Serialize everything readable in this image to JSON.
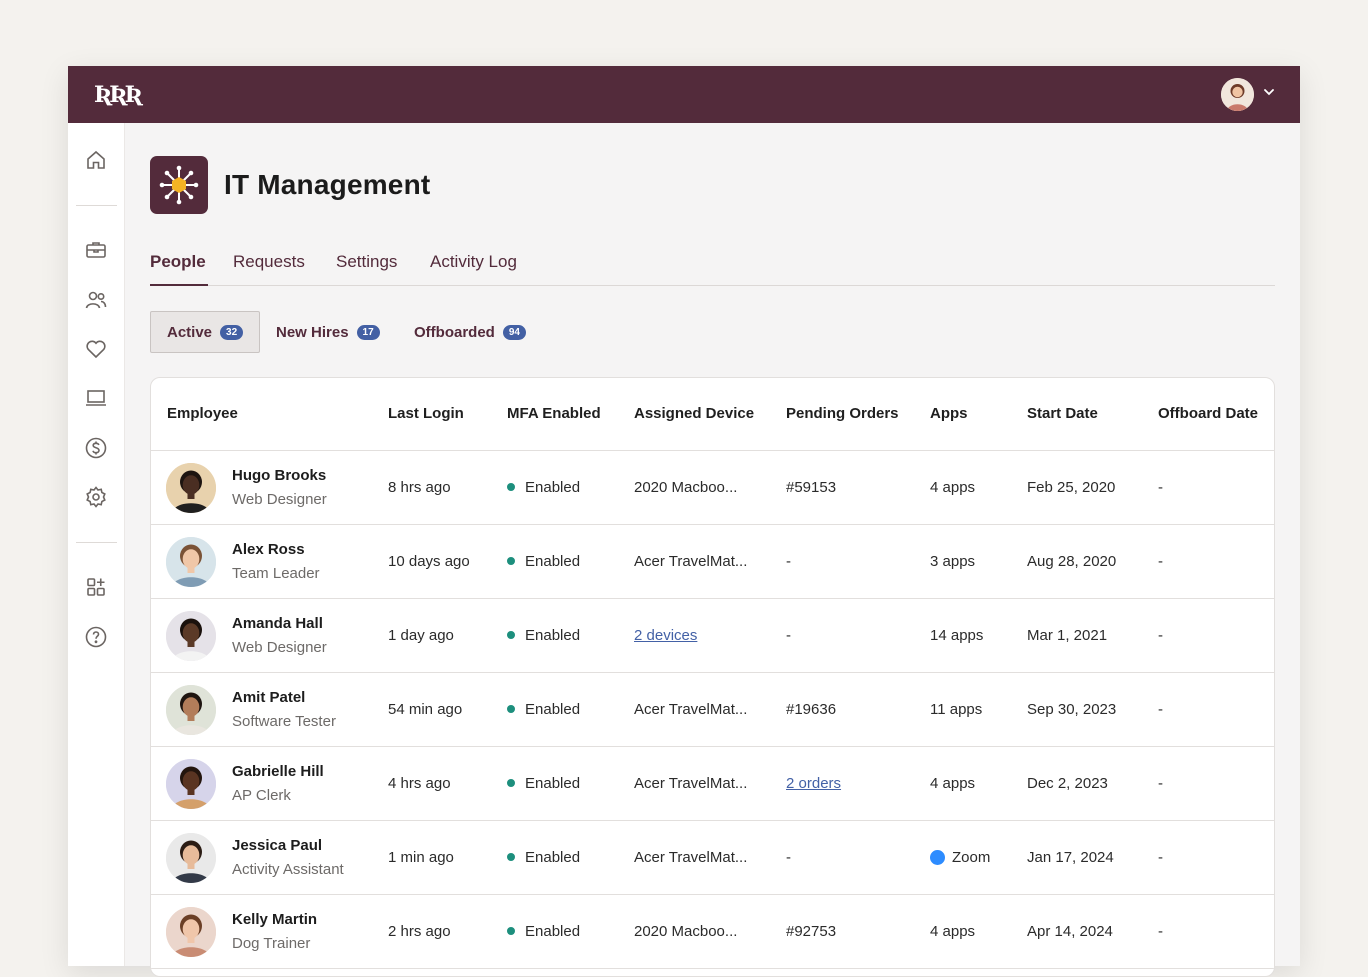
{
  "app": {
    "title": "IT Management",
    "logo_text": "ƦƦƦ"
  },
  "topbar": {
    "bg_color": "#532b3b"
  },
  "sidebar": {
    "icons": [
      "home-icon",
      "briefcase-icon",
      "people-icon",
      "heart-icon",
      "laptop-icon",
      "dollar-icon",
      "gear-icon",
      "apps-add-icon",
      "help-icon"
    ]
  },
  "tabs": [
    {
      "label": "People",
      "active": true
    },
    {
      "label": "Requests"
    },
    {
      "label": "Settings"
    },
    {
      "label": "Activity Log"
    }
  ],
  "filters": [
    {
      "label": "Active",
      "count": "32",
      "active": true
    },
    {
      "label": "New Hires",
      "count": "17"
    },
    {
      "label": "Offboarded",
      "count": "94"
    }
  ],
  "table": {
    "headers": [
      "Employee",
      "Last Login",
      "MFA Enabled",
      "Assigned Device",
      "Pending Orders",
      "Apps",
      "Start Date",
      "Offboard Date"
    ],
    "rows": [
      {
        "name": "Hugo Brooks",
        "role": "Web Designer",
        "last_login": "8 hrs ago",
        "mfa": "Enabled",
        "device": "2020 Macboo...",
        "orders": "#59153",
        "apps": "4 apps",
        "start": "Feb 25, 2020",
        "offboard": "-",
        "avatar_bg": "#e8d2ad",
        "skin": "#4a2e22",
        "hair": "#1d1410",
        "shirt": "#1f1f1f"
      },
      {
        "name": "Alex Ross",
        "role": "Team Leader",
        "last_login": "10 days ago",
        "mfa": "Enabled",
        "device": "Acer TravelMat...",
        "orders": "-",
        "apps": "3 apps",
        "start": "Aug 28, 2020",
        "offboard": "-",
        "avatar_bg": "#d7e4ea",
        "skin": "#f0c7a8",
        "hair": "#7a5236",
        "shirt": "#7f9cb4"
      },
      {
        "name": "Amanda Hall",
        "role": "Web Designer",
        "last_login": "1 day ago",
        "mfa": "Enabled",
        "device": "2 devices",
        "device_link": true,
        "orders": "-",
        "apps": "14 apps",
        "start": "Mar 1, 2021",
        "offboard": "-",
        "avatar_bg": "#e5e2e8",
        "skin": "#5b3a27",
        "hair": "#1a110c",
        "shirt": "#f3f3f3"
      },
      {
        "name": "Amit Patel",
        "role": "Software Tester",
        "last_login": "54 min ago",
        "mfa": "Enabled",
        "device": "Acer TravelMat...",
        "orders": "#19636",
        "apps": "11 apps",
        "start": "Sep 30, 2023",
        "offboard": "-",
        "avatar_bg": "#dfe3d8",
        "skin": "#b27d5a",
        "hair": "#1e1510",
        "shirt": "#e9e6df"
      },
      {
        "name": "Gabrielle Hill",
        "role": "AP Clerk",
        "last_login": "4 hrs ago",
        "mfa": "Enabled",
        "device": "Acer TravelMat...",
        "orders": "2 orders",
        "orders_link": true,
        "apps": "4 apps",
        "start": "Dec 2, 2023",
        "offboard": "-",
        "avatar_bg": "#d6d4ea",
        "skin": "#5a3422",
        "hair": "#24150e",
        "shirt": "#d4a06b"
      },
      {
        "name": "Jessica Paul",
        "role": "Activity Assistant",
        "last_login": "1 min ago",
        "mfa": "Enabled",
        "device": "Acer TravelMat...",
        "orders": "-",
        "apps": "Zoom",
        "apps_zoom": true,
        "start": "Jan 17, 2024",
        "offboard": "-",
        "avatar_bg": "#e9e9e9",
        "skin": "#e7bb9a",
        "hair": "#2b1c14",
        "shirt": "#333a48"
      },
      {
        "name": "Kelly Martin",
        "role": "Dog Trainer",
        "last_login": "2 hrs ago",
        "mfa": "Enabled",
        "device": "2020 Macboo...",
        "orders": "#92753",
        "apps": "4 apps",
        "start": "Apr 14, 2024",
        "offboard": "-",
        "avatar_bg": "#ebd6cc",
        "skin": "#f0c6aa",
        "hair": "#6b3f26",
        "shirt": "#c98c74"
      }
    ]
  }
}
